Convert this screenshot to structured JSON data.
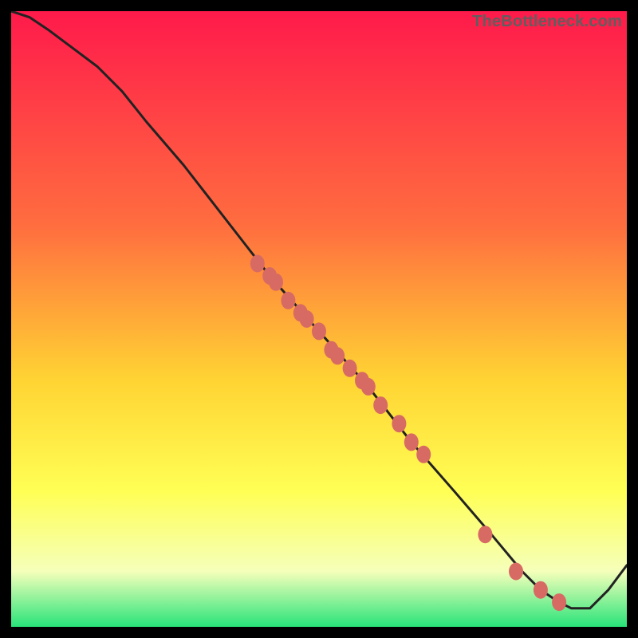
{
  "watermark": "TheBottleneck.com",
  "colors": {
    "bg": "#000000",
    "curve": "#222222",
    "point_fill": "#d86a64",
    "point_stroke": "#b84f4a",
    "grad_top": "#ff1a4b",
    "grad_mid1": "#ff6e3f",
    "grad_mid2": "#ffd433",
    "grad_mid3": "#ffff55",
    "grad_mid4": "#f5ffba",
    "grad_bottom": "#28e47a"
  },
  "chart_data": {
    "type": "line",
    "title": "",
    "xlabel": "",
    "ylabel": "",
    "xlim": [
      0,
      100
    ],
    "ylim": [
      0,
      100
    ],
    "grid": false,
    "legend": false,
    "series": [
      {
        "name": "bottleneck-curve",
        "x": [
          0,
          3,
          6,
          10,
          14,
          18,
          22,
          28,
          35,
          42,
          50,
          58,
          65,
          72,
          78,
          83,
          86,
          89,
          91,
          94,
          97,
          100
        ],
        "y": [
          100,
          99,
          97,
          94,
          91,
          87,
          82,
          75,
          66,
          57,
          48,
          39,
          30,
          22,
          15,
          9,
          6,
          4,
          3,
          3,
          6,
          10
        ]
      }
    ],
    "points": {
      "name": "highlight-dots",
      "x": [
        40,
        42,
        43,
        45,
        47,
        48,
        50,
        52,
        53,
        55,
        57,
        58,
        60,
        63,
        65,
        67,
        77,
        82,
        86,
        89
      ],
      "y": [
        59,
        57,
        56,
        53,
        51,
        50,
        48,
        45,
        44,
        42,
        40,
        39,
        36,
        33,
        30,
        28,
        15,
        9,
        6,
        4
      ]
    }
  }
}
